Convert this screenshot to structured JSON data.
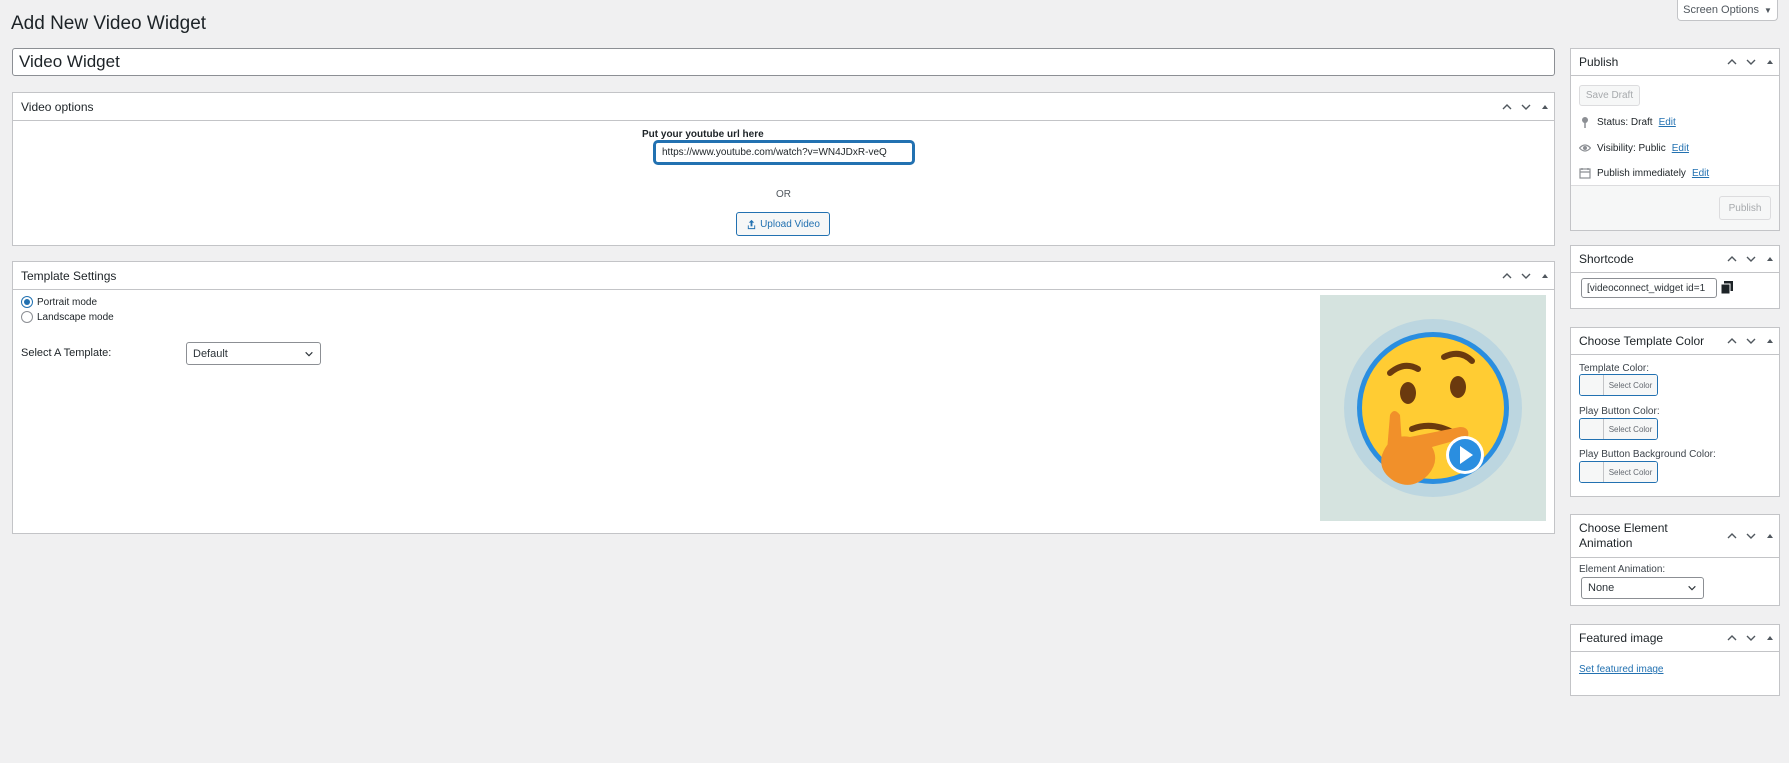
{
  "page": {
    "title": "Add New Video Widget",
    "screen_options": "Screen Options"
  },
  "post_title": {
    "value": "Video Widget"
  },
  "video_options": {
    "title": "Video options",
    "youtube_label": "Put your youtube url here",
    "youtube_url": "https://www.youtube.com/watch?v=WN4JDxR-veQ",
    "or_text": "OR",
    "upload_label": "Upload Video"
  },
  "template_settings": {
    "title": "Template Settings",
    "modes": [
      {
        "label": "Portrait mode",
        "checked": true
      },
      {
        "label": "Landscape mode",
        "checked": false
      }
    ],
    "select_label": "Select A Template:",
    "selected_template": "Default"
  },
  "publish": {
    "title": "Publish",
    "save_draft": "Save Draft",
    "status_label": "Status: Draft",
    "visibility_label": "Visibility: Public",
    "schedule_label": "Publish immediately",
    "edit_link": "Edit",
    "publish_button": "Publish"
  },
  "shortcode": {
    "title": "Shortcode",
    "value": "[videoconnect_widget id=1"
  },
  "template_color": {
    "title": "Choose Template Color",
    "select_color": "Select Color",
    "fields": [
      {
        "label": "Template Color:"
      },
      {
        "label": "Play Button Color:"
      },
      {
        "label": "Play Button Background Color:"
      }
    ]
  },
  "element_animation": {
    "title_line1": "Choose Element",
    "title_line2": "Animation",
    "label": "Element Animation:",
    "value": "None"
  },
  "featured_image": {
    "title": "Featured image",
    "link": "Set featured image"
  },
  "colors": {
    "accent": "#2271b1",
    "background": "#f0f0f1",
    "border": "#c3c4c7"
  },
  "icons": [
    "chevron-up-icon",
    "chevron-down-icon",
    "triangle-up-icon",
    "pin-icon",
    "eye-icon",
    "calendar-icon",
    "upload-icon",
    "copy-icon",
    "caret-down-icon"
  ]
}
